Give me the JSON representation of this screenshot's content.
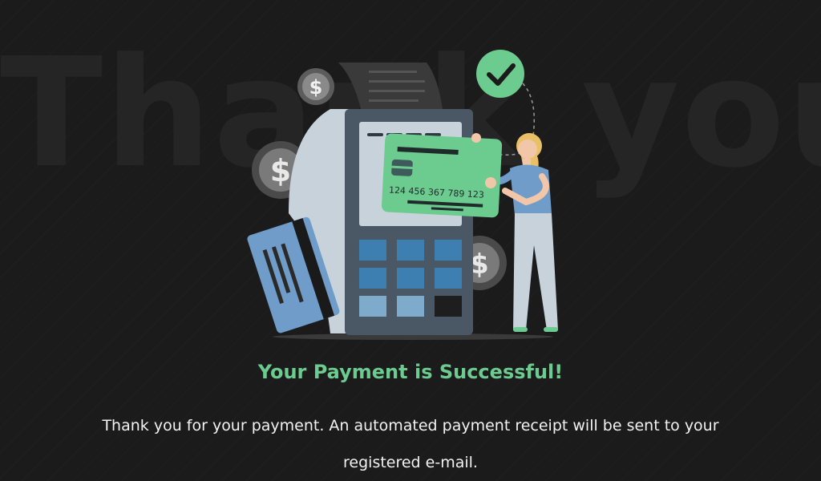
{
  "background": {
    "watermark_text": "Thank you!",
    "color": "#1b1b1b"
  },
  "illustration": {
    "card_number": "124 456 367 789 123",
    "icons": [
      "check-circle-icon",
      "dollar-coin-icon",
      "payment-terminal",
      "credit-card",
      "person"
    ]
  },
  "content": {
    "headline": "Your Payment is Successful!",
    "message": "Thank you for your payment. An automated payment receipt will be sent to your registered e-mail."
  },
  "colors": {
    "accent_green": "#6ccb8f",
    "terminal_dark": "#4a5866",
    "keypad_blue": "#3d7fb0",
    "card_blue": "#6f9cc9",
    "text": "#f2f2f2"
  }
}
